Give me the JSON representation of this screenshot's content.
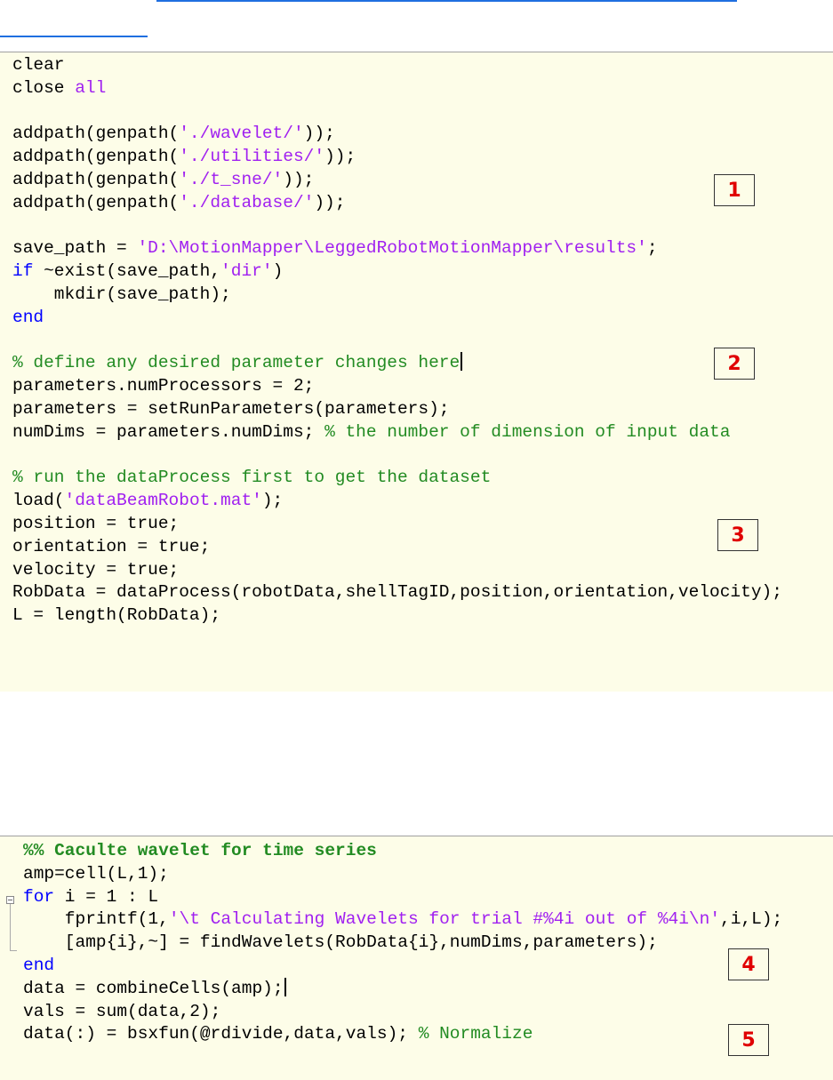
{
  "colors": {
    "keyword": "#0000ff",
    "string": "#a020f0",
    "comment": "#228b22",
    "badge_text": "#e00000",
    "editor_bg": "#fdfde8",
    "link_line": "#1f6fe0"
  },
  "icons": {
    "fold": "collapse-minus-icon"
  },
  "badges": {
    "b1": "1",
    "b2": "2",
    "b3": "3",
    "b4": "4",
    "b5": "5"
  },
  "panel1": {
    "lines": [
      [
        "clear"
      ],
      [
        "close ",
        "all"
      ],
      [
        ""
      ],
      [
        "addpath(genpath(",
        "'./wavelet/'",
        "));"
      ],
      [
        "addpath(genpath(",
        "'./utilities/'",
        "));"
      ],
      [
        "addpath(genpath(",
        "'./t_sne/'",
        "));"
      ],
      [
        "addpath(genpath(",
        "'./database/'",
        "));"
      ],
      [
        ""
      ],
      [
        "save_path = ",
        "'D:\\MotionMapper\\LeggedRobotMotionMapper\\results'",
        ";"
      ],
      [
        "if",
        " ~exist(save_path,",
        "'dir'",
        ")"
      ],
      [
        "    mkdir(save_path);"
      ],
      [
        "end"
      ],
      [
        ""
      ],
      [
        "% define any desired parameter changes here"
      ],
      [
        "parameters.numProcessors = 2;"
      ],
      [
        "parameters = setRunParameters(parameters);"
      ],
      [
        "numDims = parameters.numDims; ",
        "% the number of dimension of input data"
      ],
      [
        ""
      ],
      [
        "% run the dataProcess first to get the dataset"
      ],
      [
        "load(",
        "'dataBeamRobot.mat'",
        ");"
      ],
      [
        "position = true;"
      ],
      [
        "orientation = true;"
      ],
      [
        "velocity = true;"
      ],
      [
        "RobData = dataProcess(robotData,shellTagID,position,orientation,velocity);"
      ],
      [
        "L = length(RobData);"
      ]
    ]
  },
  "panel2": {
    "lines": [
      [
        "%% Caculte wavelet for time series"
      ],
      [
        "amp=cell(L,1);"
      ],
      [
        "for",
        " i = 1 : L"
      ],
      [
        "    fprintf(1,",
        "'\\t Calculating Wavelets for trial #%4i out of %4i\\n'",
        ",i,L);"
      ],
      [
        "    [amp{i},~] = findWavelets(RobData{i},numDims,parameters);"
      ],
      [
        "end"
      ],
      [
        "data = combineCells(amp);"
      ],
      [
        "vals = sum(data,2);"
      ],
      [
        "data(:) = bsxfun(@rdivide,data,vals); ",
        "% Normalize"
      ]
    ]
  }
}
